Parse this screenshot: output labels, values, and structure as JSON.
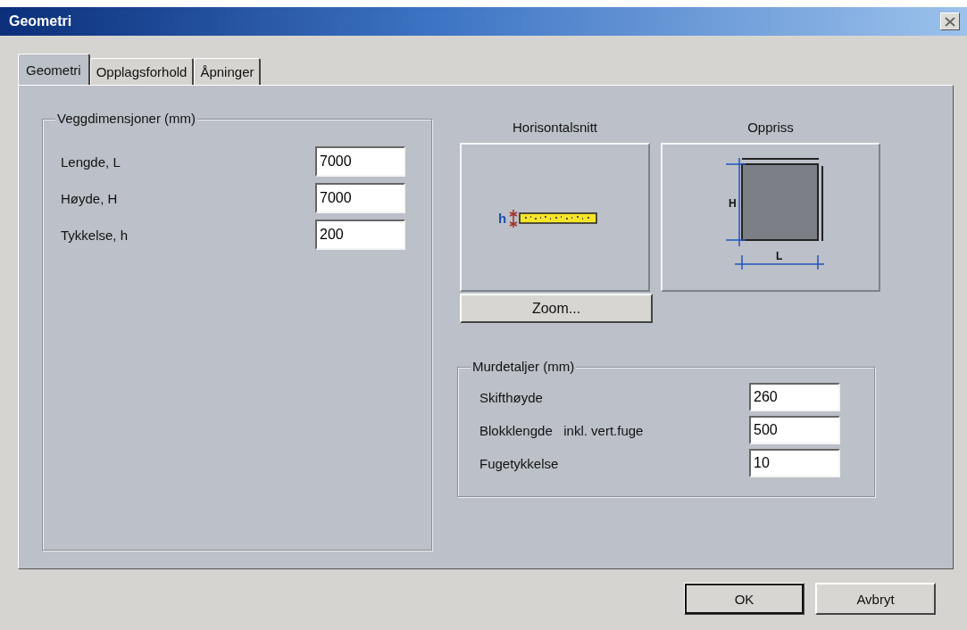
{
  "window": {
    "title": "Geometri"
  },
  "tabs": [
    {
      "label": "Geometri",
      "selected": true
    },
    {
      "label": "Opplagsforhold",
      "selected": false
    },
    {
      "label": "Åpninger",
      "selected": false
    }
  ],
  "wall_dimensions": {
    "title": "Veggdimensjoner (mm)",
    "fields": [
      {
        "label": "Lengde, L",
        "value": "7000"
      },
      {
        "label": "Høyde, H",
        "value": "7000"
      },
      {
        "label": "Tykkelse, h",
        "value": "200"
      }
    ]
  },
  "previews": [
    {
      "kind": "section",
      "title": "Horisontalsnitt",
      "labels": [
        "h"
      ]
    },
    {
      "kind": "elevation",
      "title": "Oppriss",
      "labels": [
        "H",
        "L"
      ]
    }
  ],
  "zoom_button": {
    "label": "Zoom..."
  },
  "masonry_details": {
    "title": "Murdetaljer (mm)",
    "fields": [
      {
        "label": "Skifthøyde",
        "value": "260"
      },
      {
        "label": "Blokklengde   inkl. vert.fuge",
        "value": "500"
      },
      {
        "label": "Fugetykkelse",
        "value": "10"
      }
    ]
  },
  "buttons": [
    {
      "label": "OK",
      "default": true
    },
    {
      "label": "Avbryt",
      "default": false
    }
  ]
}
